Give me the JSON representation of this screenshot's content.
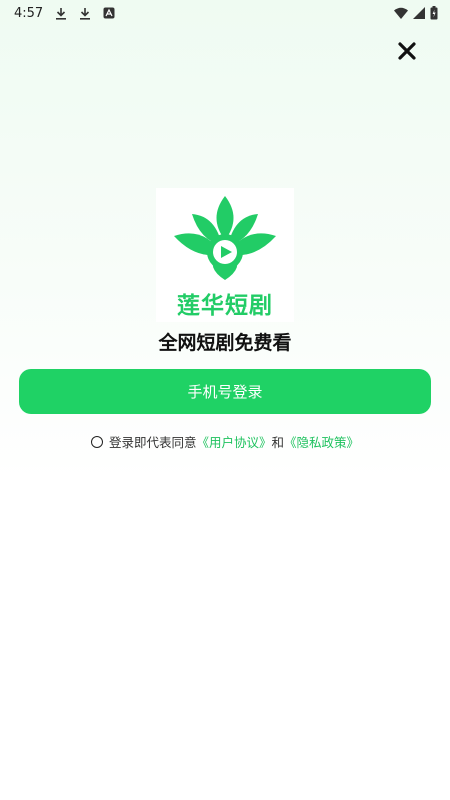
{
  "status_bar": {
    "time": "4:57",
    "icons": [
      "download-icon",
      "download-icon",
      "store-icon"
    ],
    "right_icons": [
      "wifi-icon",
      "signal-icon",
      "battery-icon"
    ]
  },
  "close_icon": "close-icon",
  "logo": {
    "text": "莲华短剧",
    "color": "#22cc66"
  },
  "tagline": "全网短剧免费看",
  "login_button": {
    "label": "手机号登录",
    "color": "#1fd265"
  },
  "agreement": {
    "prefix": "登录即代表同意",
    "user_agreement": "《用户协议》",
    "conjunction": "和",
    "privacy_policy": "《隐私政策》",
    "link_color": "#1fc25f"
  }
}
